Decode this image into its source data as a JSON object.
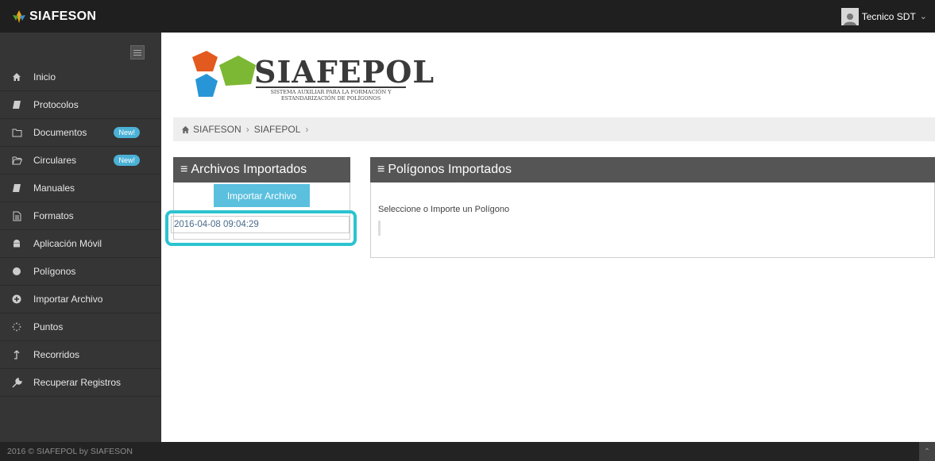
{
  "header": {
    "brand": "SIAFESON",
    "user_name": "Tecnico SDT"
  },
  "sidebar": {
    "items": [
      {
        "label": "Inicio",
        "icon": "home-icon"
      },
      {
        "label": "Protocolos",
        "icon": "book-icon"
      },
      {
        "label": "Documentos",
        "icon": "folder-icon",
        "badge": "New!"
      },
      {
        "label": "Circulares",
        "icon": "folder-open-icon",
        "badge": "New!"
      },
      {
        "label": "Manuales",
        "icon": "book-icon"
      },
      {
        "label": "Formatos",
        "icon": "file-icon"
      },
      {
        "label": "Aplicación Móvil",
        "icon": "android-icon"
      },
      {
        "label": "Polígonos",
        "icon": "circle-icon"
      },
      {
        "label": "Importar Archivo",
        "icon": "plus-circle-icon"
      },
      {
        "label": "Puntos",
        "icon": "spinner-icon"
      },
      {
        "label": "Recorridos",
        "icon": "route-icon"
      },
      {
        "label": "Recuperar Registros",
        "icon": "wrench-icon"
      }
    ]
  },
  "logo": {
    "title": "SIAFEPOL",
    "subtitle_line1": "SISTEMA AUXILIAR PARA LA FORMACIÓN Y",
    "subtitle_line2": "ESTANDARIZACIÓN DE POLÍGONOS"
  },
  "breadcrumb": {
    "items": [
      "SIAFESON",
      "SIAFEPOL"
    ]
  },
  "archivos_panel": {
    "title": "Archivos Importados",
    "import_button": "Importar Archivo",
    "files": [
      "2016-04-08 09:04:29"
    ]
  },
  "poligonos_panel": {
    "title": "Polígonos Importados",
    "message": "Seleccione o Importe un Polígono"
  },
  "footer": {
    "text": "2016 © SIAFEPOL by SIAFESON"
  },
  "colors": {
    "topbar": "#1f1f1f",
    "sidebar": "#353535",
    "badge": "#4bb1d6",
    "button": "#5bc0de",
    "highlight": "#2bc3d0",
    "panel_header": "#555555"
  }
}
